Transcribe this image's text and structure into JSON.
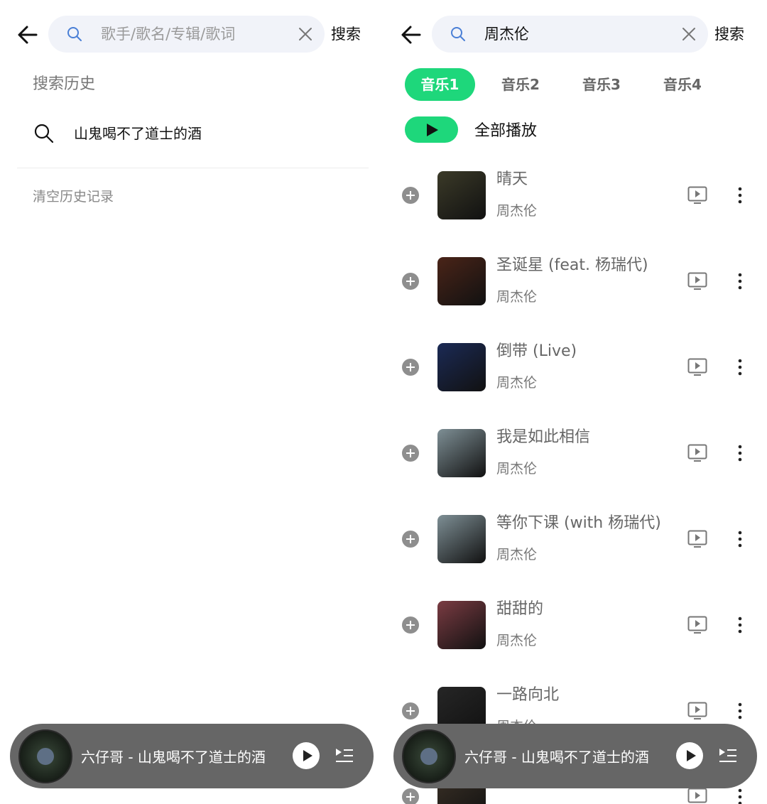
{
  "left": {
    "search": {
      "placeholder": "歌手/歌名/专辑/歌词",
      "button": "搜索"
    },
    "history": {
      "title": "搜索历史",
      "items": [
        {
          "text": "山鬼喝不了道士的酒"
        }
      ],
      "clear_label": "清空历史记录"
    },
    "player": {
      "now_playing": "六仔哥 - 山鬼喝不了道士的酒"
    }
  },
  "right": {
    "search": {
      "query": "周杰伦",
      "button": "搜索"
    },
    "tabs": [
      {
        "label": "音乐1",
        "active": true
      },
      {
        "label": "音乐2",
        "active": false
      },
      {
        "label": "音乐3",
        "active": false
      },
      {
        "label": "音乐4",
        "active": false
      }
    ],
    "play_all_label": "全部播放",
    "songs": [
      {
        "title": "晴天",
        "artist": "周杰伦",
        "cover_color": "#3b3a28"
      },
      {
        "title": "圣诞星 (feat. 杨瑞代)",
        "artist": "周杰伦",
        "cover_color": "#4a2418"
      },
      {
        "title": "倒带 (Live)",
        "artist": "周杰伦",
        "cover_color": "#1b2a55"
      },
      {
        "title": "我是如此相信",
        "artist": "周杰伦",
        "cover_color": "#7e8f95"
      },
      {
        "title": "等你下课 (with 杨瑞代)",
        "artist": "周杰伦",
        "cover_color": "#7e8f95"
      },
      {
        "title": "甜甜的",
        "artist": "周杰伦",
        "cover_color": "#7a3b42"
      },
      {
        "title": "一路向北",
        "artist": "周杰伦",
        "cover_color": "#262626"
      },
      {
        "title": "",
        "artist": "",
        "cover_color": "#3a3026"
      }
    ],
    "player": {
      "now_playing": "六仔哥 - 山鬼喝不了道士的酒"
    }
  },
  "colors": {
    "accent": "#1ed77b",
    "player_bg": "#666666",
    "search_bg": "#f1f3f9",
    "search_icon": "#4a7fd6"
  },
  "icons": {
    "back": "arrow-left-icon",
    "search": "search-icon",
    "clear": "close-icon",
    "add": "plus-circle-icon",
    "mv": "video-icon",
    "more": "more-vertical-icon",
    "play": "play-icon",
    "playlist": "playlist-icon"
  }
}
